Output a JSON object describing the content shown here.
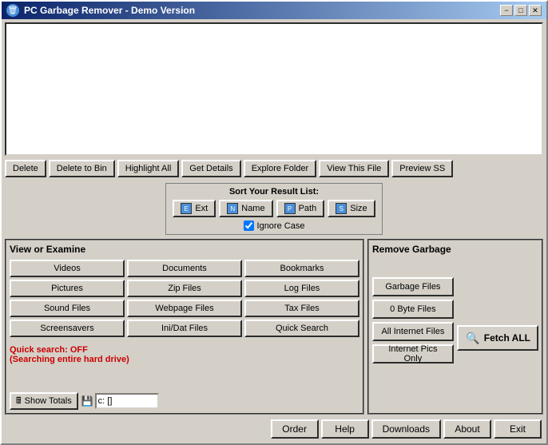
{
  "window": {
    "title": "PC Garbage Remover - Demo Version",
    "icon": "🗑"
  },
  "titlebar": {
    "minimize": "−",
    "maximize": "□",
    "close": "✕"
  },
  "toolbar": {
    "delete_label": "Delete",
    "delete_bin_label": "Delete to Bin",
    "highlight_all_label": "Highlight All",
    "get_details_label": "Get Details",
    "explore_folder_label": "Explore Folder",
    "view_this_label": "View This File",
    "preview_ss_label": "Preview SS"
  },
  "sort": {
    "title": "Sort Your Result List:",
    "ext_label": "Ext",
    "name_label": "Name",
    "path_label": "Path",
    "size_label": "Size",
    "ignore_case_label": "Ignore Case",
    "ignore_case_checked": true
  },
  "view_panel": {
    "title": "View or Examine",
    "buttons": [
      "Videos",
      "Documents",
      "Bookmarks",
      "Pictures",
      "Zip Files",
      "Log Files",
      "Sound Files",
      "Webpage Files",
      "Tax Files",
      "Screensavers",
      "Ini/Dat Files",
      "Quick Search"
    ],
    "quick_search_status": "Quick search: OFF",
    "quick_search_sub": "(Searching entire hard drive)",
    "show_totals_label": "Show Totals",
    "drive_label": "c: []"
  },
  "remove_panel": {
    "title": "Remove Garbage",
    "garbage_files_label": "Garbage Files",
    "zero_byte_label": "0 Byte Files",
    "all_internet_label": "All Internet Files",
    "internet_pics_label": "Internet Pics Only",
    "fetch_label": "Fetch ALL",
    "fetch_icon": "🔍"
  },
  "footer": {
    "order_label": "Order",
    "help_label": "Help",
    "downloads_label": "Downloads",
    "about_label": "About",
    "exit_label": "Exit"
  }
}
